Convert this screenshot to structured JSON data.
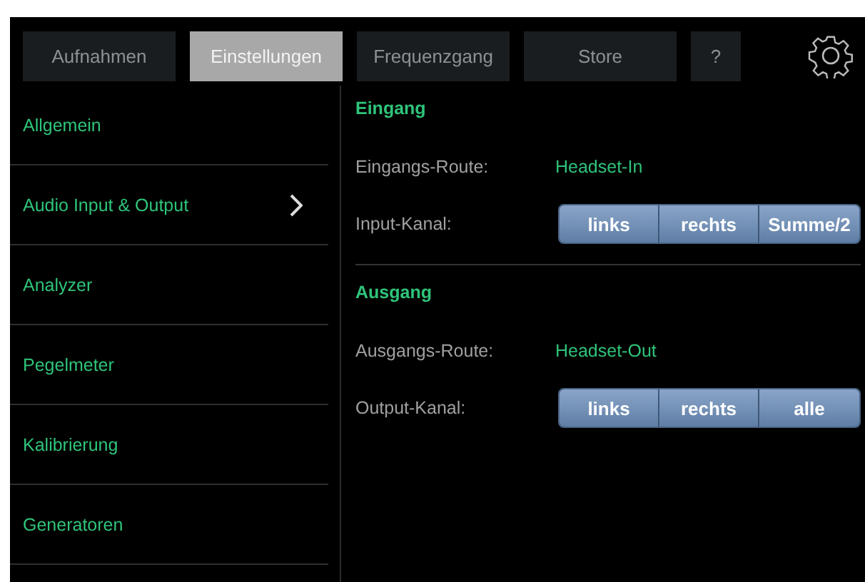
{
  "tabs": [
    {
      "label": "Aufnahmen",
      "selected": false
    },
    {
      "label": "Einstellungen",
      "selected": true
    },
    {
      "label": "Frequenzgang",
      "selected": false
    },
    {
      "label": "Store",
      "selected": false
    },
    {
      "label": "?",
      "selected": false
    }
  ],
  "sidebar": {
    "items": [
      {
        "label": "Allgemein",
        "expanded": false
      },
      {
        "label": "Audio Input & Output",
        "expanded": true
      },
      {
        "label": "Analyzer",
        "expanded": false
      },
      {
        "label": "Pegelmeter",
        "expanded": false
      },
      {
        "label": "Kalibrierung",
        "expanded": false
      },
      {
        "label": "Generatoren",
        "expanded": false
      }
    ]
  },
  "sections": [
    {
      "title": "Eingang",
      "route_label": "Eingangs-Route:",
      "route_value": "Headset-In",
      "channel_label": "Input-Kanal:",
      "channel_options": [
        "links",
        "rechts",
        "Summe/2"
      ]
    },
    {
      "title": "Ausgang",
      "route_label": "Ausgangs-Route:",
      "route_value": "Headset-Out",
      "channel_label": "Output-Kanal:",
      "channel_options": [
        "links",
        "rechts",
        "alle"
      ]
    }
  ]
}
